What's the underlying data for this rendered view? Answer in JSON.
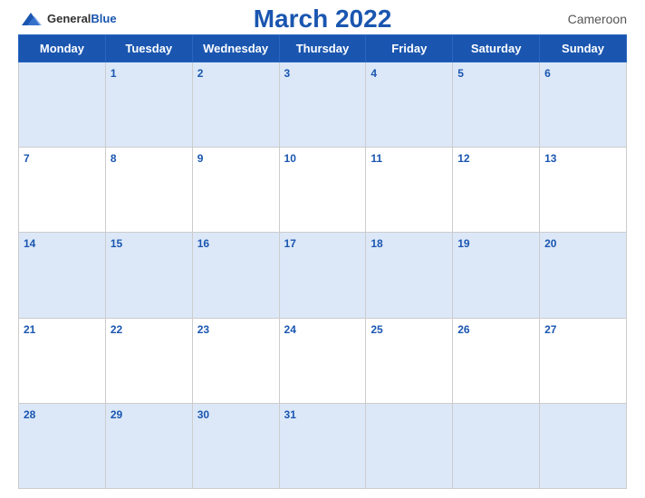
{
  "header": {
    "title": "March 2022",
    "country": "Cameroon",
    "logo_general": "General",
    "logo_blue": "Blue"
  },
  "weekdays": [
    "Monday",
    "Tuesday",
    "Wednesday",
    "Thursday",
    "Friday",
    "Saturday",
    "Sunday"
  ],
  "weeks": [
    [
      null,
      1,
      2,
      3,
      4,
      5,
      6
    ],
    [
      7,
      8,
      9,
      10,
      11,
      12,
      13
    ],
    [
      14,
      15,
      16,
      17,
      18,
      19,
      20
    ],
    [
      21,
      22,
      23,
      24,
      25,
      26,
      27
    ],
    [
      28,
      29,
      30,
      31,
      null,
      null,
      null
    ]
  ]
}
